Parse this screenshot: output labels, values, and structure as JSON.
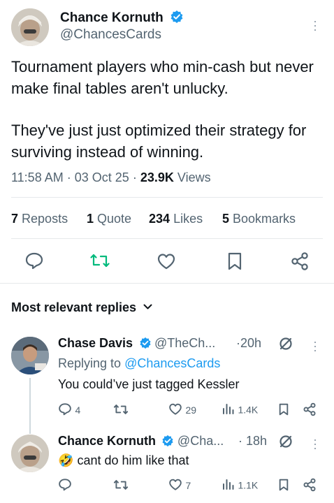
{
  "tweet": {
    "author_name": "Chance Kornuth",
    "author_handle": "@ChancesCards",
    "text_p1": "Tournament players who min-cash but never make final tables aren't unlucky.",
    "text_p2": "They've just just optimized their strategy for surviving instead of winning.",
    "time": "11:58 AM",
    "date": "03 Oct 25",
    "views_count": "23.9K",
    "views_label": "Views",
    "sep": "·"
  },
  "stats": {
    "reposts_count": "7",
    "reposts_label": "Reposts",
    "quotes_count": "1",
    "quotes_label": "Quote",
    "likes_count": "234",
    "likes_label": "Likes",
    "bookmarks_count": "5",
    "bookmarks_label": "Bookmarks"
  },
  "actions": {
    "icons": [
      "reply-icon",
      "repost-icon",
      "like-icon",
      "bookmark-icon",
      "share-icon"
    ],
    "repost_color": "#00ba7c"
  },
  "replies_section": {
    "title": "Most relevant replies"
  },
  "replies": [
    {
      "name": "Chase Davis",
      "handle": "@TheCh...",
      "age": "·20h",
      "replying_prefix": "Replying to",
      "replying_to": "@ChancesCards",
      "text": "You could’ve just tagged Kessler",
      "reply_count": "4",
      "repost_count": "",
      "like_count": "29",
      "view_count": "1.4K"
    },
    {
      "name": "Chance Kornuth",
      "handle": "@Cha...",
      "age": "· 18h",
      "emoji": "🤣",
      "text": "cant do him like that",
      "reply_count": "",
      "repost_count": "",
      "like_count": "7",
      "view_count": "1.1K"
    }
  ],
  "colors": {
    "verified_blue": "#1d9bf0",
    "text": "#0f1419",
    "muted": "#536471",
    "divider": "#e6e9eb"
  }
}
